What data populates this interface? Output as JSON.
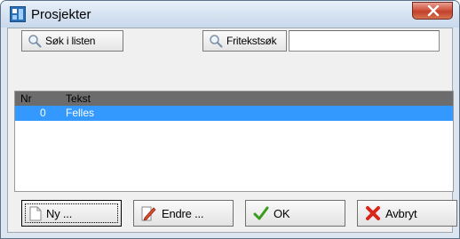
{
  "window": {
    "title": "Prosjekter",
    "close_glyph": "X"
  },
  "toolbar": {
    "search_list_label": "Søk i listen",
    "search_list_icon": "magnifier-icon",
    "freetext_label": "Fritekstsøk",
    "freetext_icon": "magnifier-icon",
    "freetext_value": "",
    "freetext_placeholder": ""
  },
  "list": {
    "columns": [
      "Nr",
      "Tekst"
    ],
    "header_color": "#6c6c6c",
    "selection_color": "#3399ff",
    "rows": [
      {
        "nr": "0",
        "tekst": "Felles",
        "selected": true
      }
    ]
  },
  "buttons": {
    "new_label": "Ny ...",
    "new_icon": "new-document-icon",
    "edit_label": "Endre ...",
    "edit_icon": "edit-pencil-icon",
    "ok_label": "OK",
    "ok_icon": "checkmark-icon",
    "cancel_label": "Avbryt",
    "cancel_icon": "red-x-icon"
  }
}
